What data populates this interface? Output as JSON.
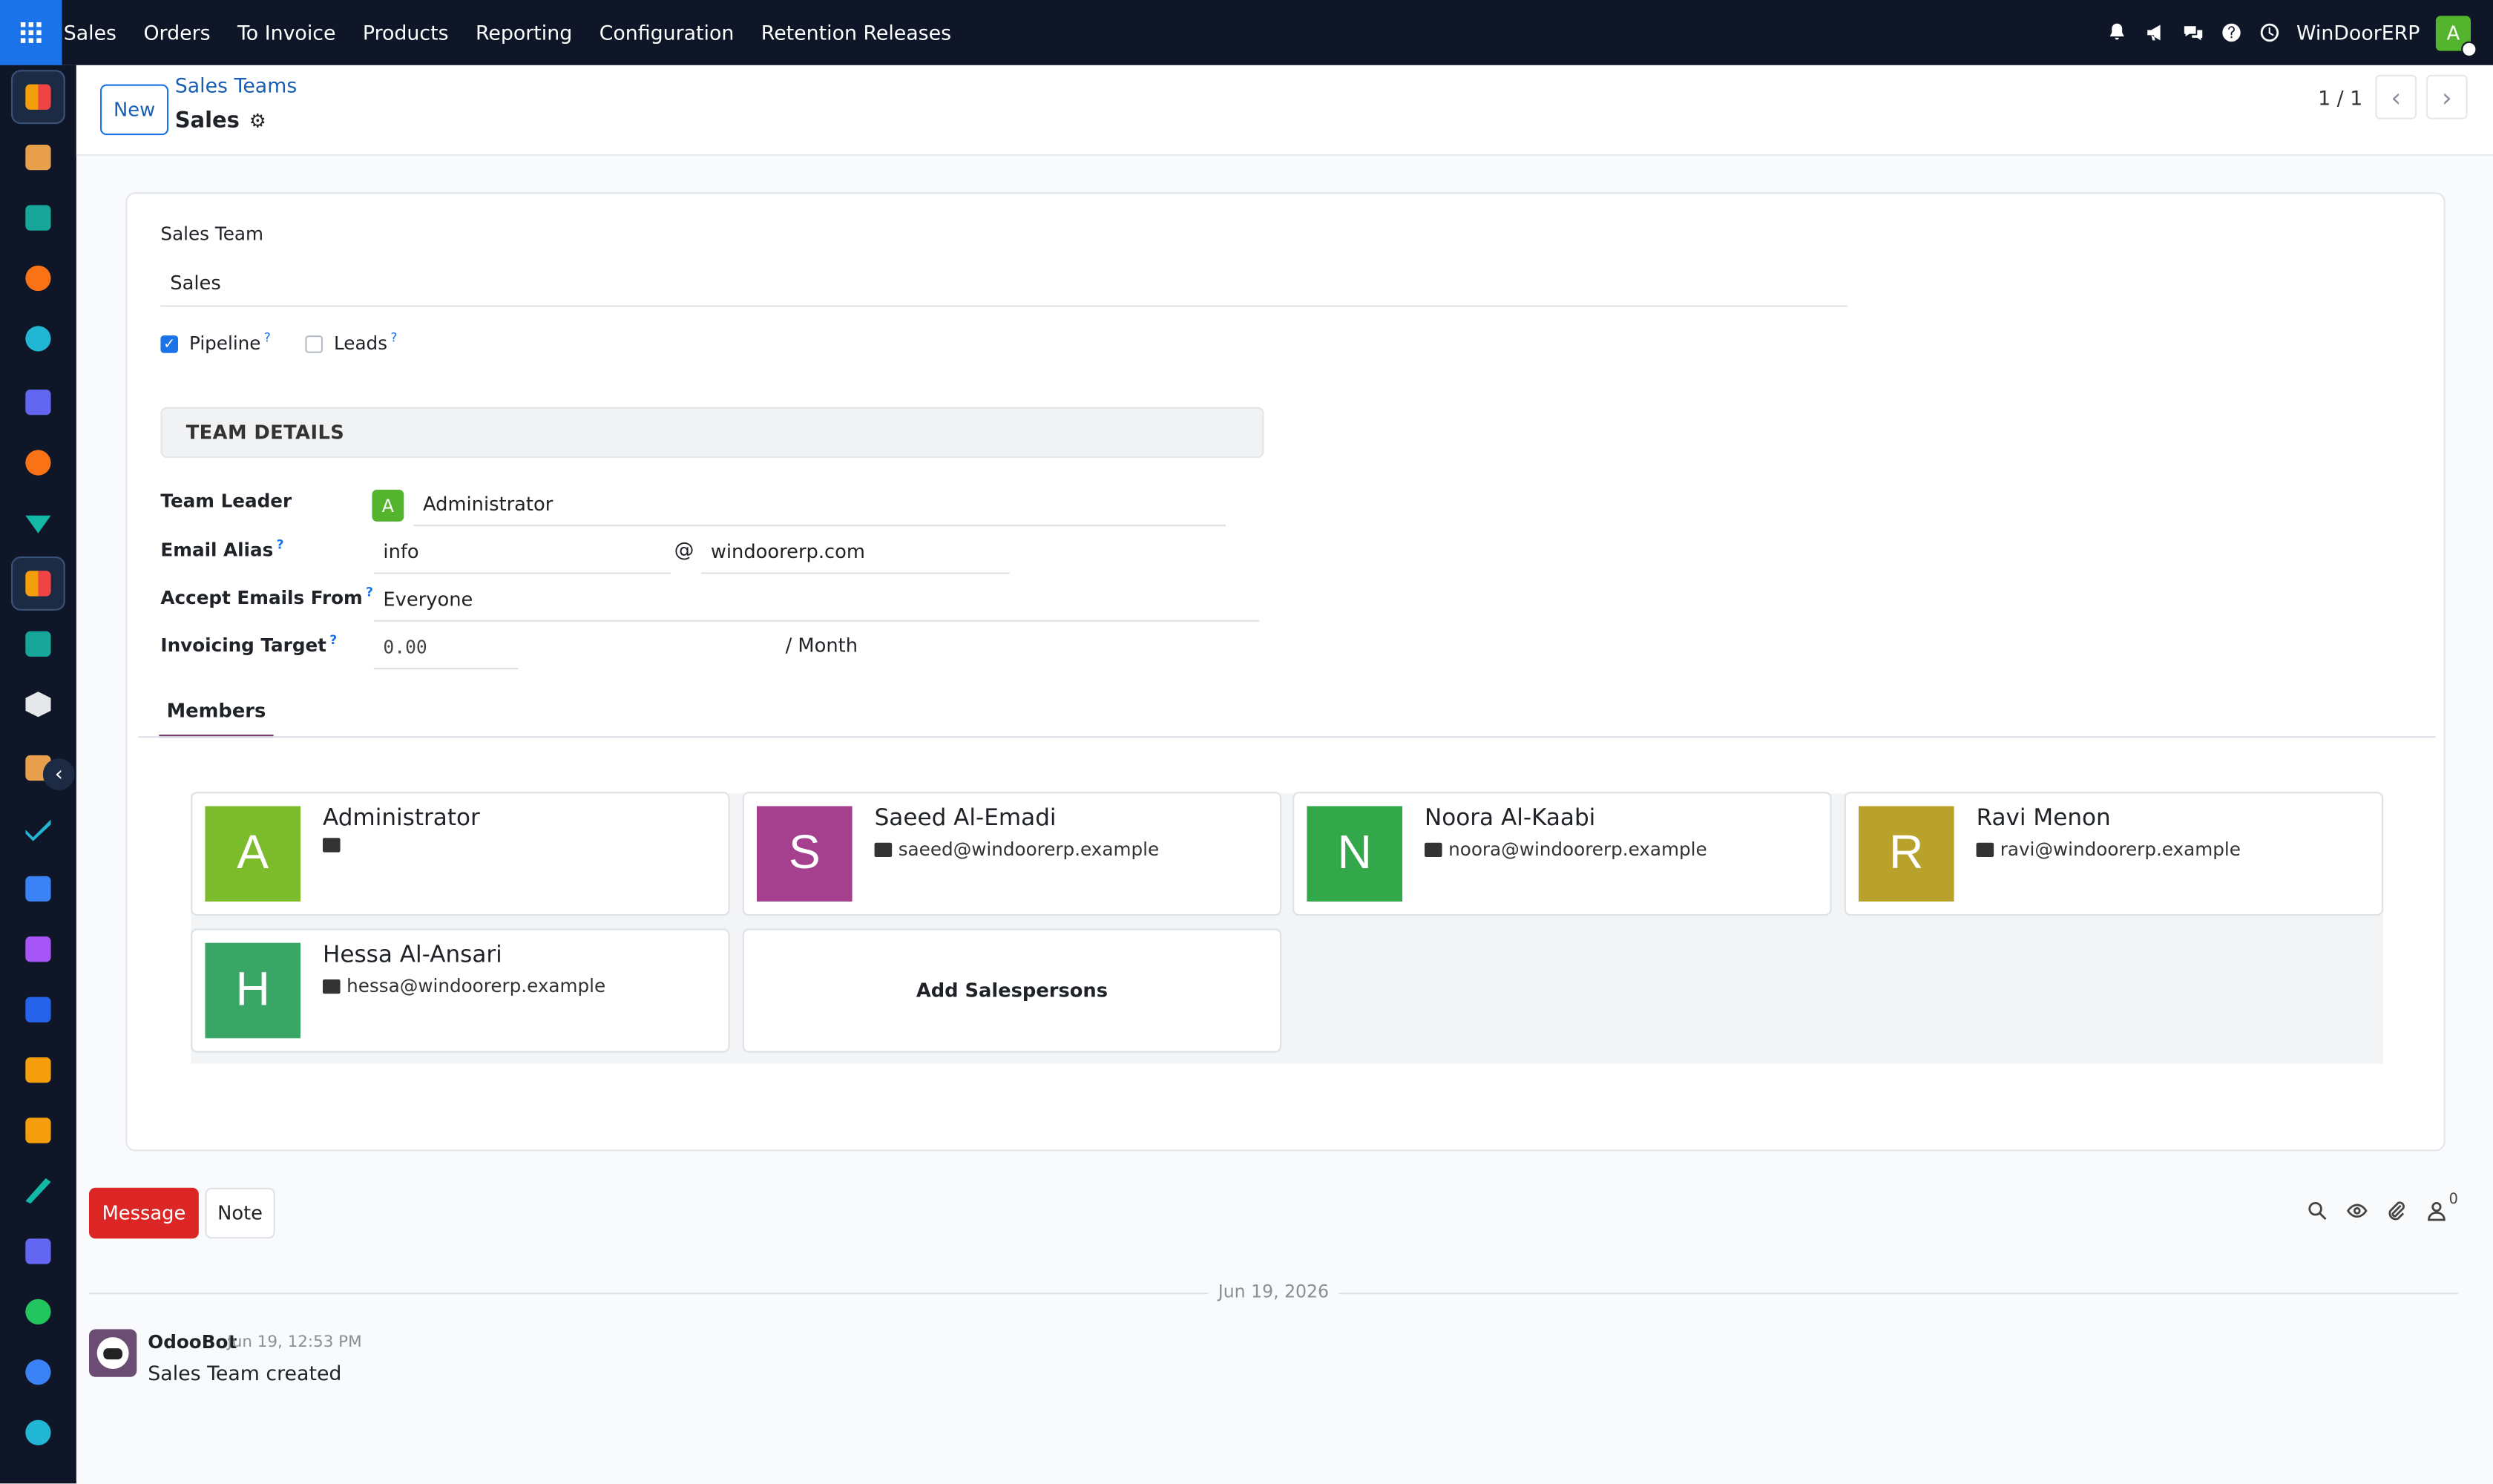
{
  "topbar": {
    "menu": [
      "Sales",
      "Orders",
      "To Invoice",
      "Products",
      "Reporting",
      "Configuration",
      "Retention Releases"
    ],
    "company": "WinDoorERP",
    "user_initial": "A"
  },
  "breadcrumb": {
    "parent": "Sales Teams",
    "current": "Sales"
  },
  "control": {
    "new_label": "New",
    "pager": "1 / 1"
  },
  "form": {
    "sales_team_label": "Sales Team",
    "sales_team_value": "Sales",
    "pipeline_label": "Pipeline",
    "pipeline_checked": true,
    "leads_label": "Leads",
    "leads_checked": false,
    "section_title": "TEAM DETAILS",
    "team_leader_label": "Team Leader",
    "team_leader_initial": "A",
    "team_leader_value": "Administrator",
    "email_alias_label": "Email Alias",
    "email_alias_value": "info",
    "email_at": "@",
    "email_domain": "windoorerp.com",
    "accept_emails_label": "Accept Emails From",
    "accept_emails_value": "Everyone",
    "invoicing_target_label": "Invoicing Target",
    "invoicing_target_value": "0.00",
    "invoicing_target_unit": "/ Month",
    "tab_members": "Members"
  },
  "members": [
    {
      "initial": "A",
      "name": "Administrator",
      "email": "",
      "color": "#7cbb2c"
    },
    {
      "initial": "S",
      "name": "Saeed Al-Emadi",
      "email": "saeed@windoorerp.example",
      "color": "#a5408f"
    },
    {
      "initial": "N",
      "name": "Noora Al-Kaabi",
      "email": "noora@windoorerp.example",
      "color": "#33a84a"
    },
    {
      "initial": "R",
      "name": "Ravi Menon",
      "email": "ravi@windoorerp.example",
      "color": "#b8a22b"
    },
    {
      "initial": "H",
      "name": "Hessa Al-Ansari",
      "email": "hessa@windoorerp.example",
      "color": "#3aa666"
    }
  ],
  "add_salespersons_label": "Add Salespersons",
  "chatter": {
    "message_label": "Message",
    "note_label": "Note",
    "follower_count": "0",
    "date_separator": "Jun 19, 2026",
    "author": "OdooBot",
    "time": "Jun 19, 12:53 PM",
    "body": "Sales Team created"
  },
  "colors": {
    "nav_bg": "#0e1627",
    "accent": "#1a73e8",
    "message_button": "#dc2626"
  }
}
